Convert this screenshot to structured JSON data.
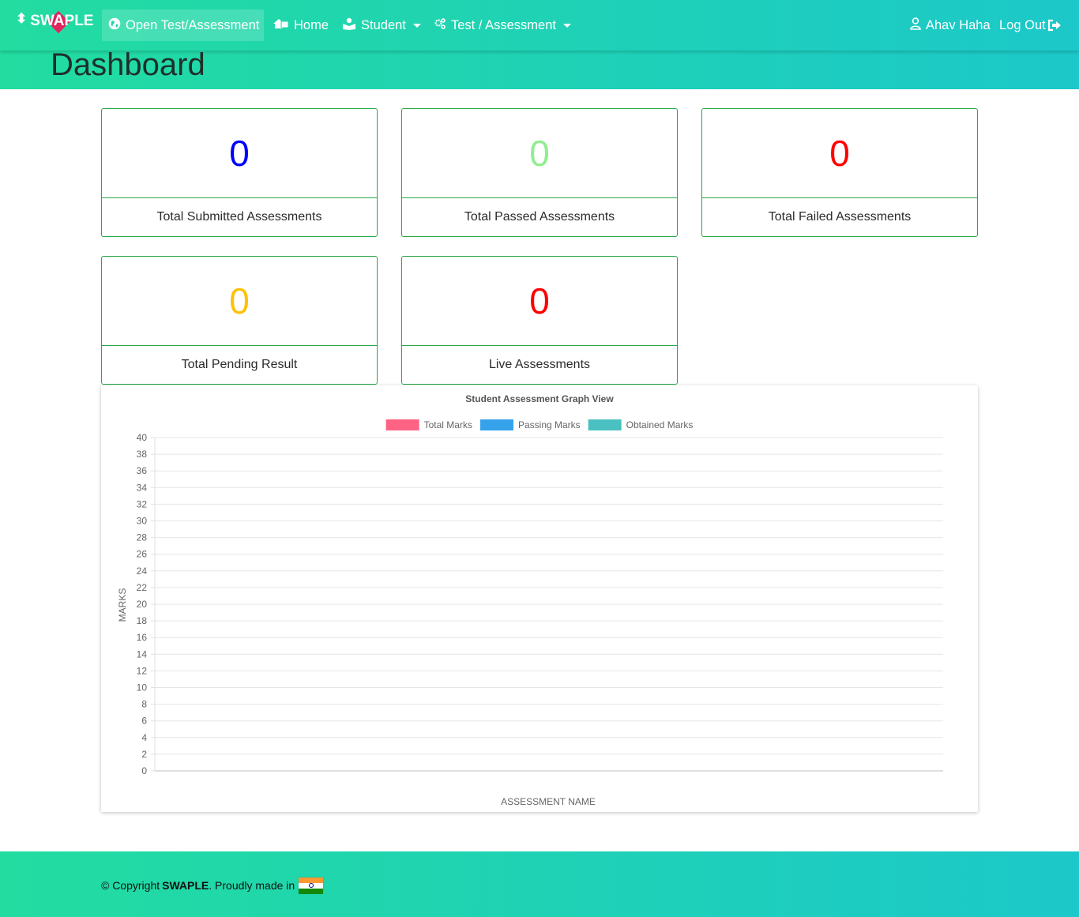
{
  "navbar": {
    "brand": "SWAPLE",
    "items": [
      {
        "label": "Open Test/Assessment",
        "icon": "globe-icon",
        "active": true
      },
      {
        "label": "Home",
        "icon": "home-icon"
      },
      {
        "label": "Student",
        "icon": "student-icon",
        "dropdown": true
      },
      {
        "label": "Test / Assessment",
        "icon": "gears-icon",
        "dropdown": true
      }
    ],
    "user": {
      "label": "Ahav Haha",
      "icon": "user-icon"
    },
    "logout": {
      "label": "Log Out",
      "icon": "sign-out-icon"
    }
  },
  "page": {
    "title": "Dashboard"
  },
  "cards": [
    {
      "value": "0",
      "label": "Total Submitted Assessments",
      "color": "#0000ff"
    },
    {
      "value": "0",
      "label": "Total Passed Assessments",
      "color": "#90ee90"
    },
    {
      "value": "0",
      "label": "Total Failed Assessments",
      "color": "#ff0000"
    },
    {
      "value": "0",
      "label": "Total Pending Result",
      "color": "#ffc107"
    },
    {
      "value": "0",
      "label": "Live Assessments",
      "color": "#ff0000"
    }
  ],
  "chart_data": {
    "type": "bar",
    "title": "Student Assessment Graph View",
    "xlabel": "ASSESSMENT NAME",
    "ylabel": "MARKS",
    "categories": [],
    "series": [
      {
        "name": "Total Marks",
        "color": "#ff6384",
        "values": []
      },
      {
        "name": "Passing Marks",
        "color": "#36a2eb",
        "values": []
      },
      {
        "name": "Obtained Marks",
        "color": "#4bc0c0",
        "values": []
      }
    ],
    "ylim": [
      0,
      40
    ],
    "yticks": [
      0,
      2,
      4,
      6,
      8,
      10,
      12,
      14,
      16,
      18,
      20,
      22,
      24,
      26,
      28,
      30,
      32,
      34,
      36,
      38,
      40
    ],
    "grid": true,
    "legend": "top"
  },
  "footer": {
    "copyright_prefix": "© Copyright",
    "brand": "SWAPLE",
    "suffix": ". Proudly made in"
  }
}
